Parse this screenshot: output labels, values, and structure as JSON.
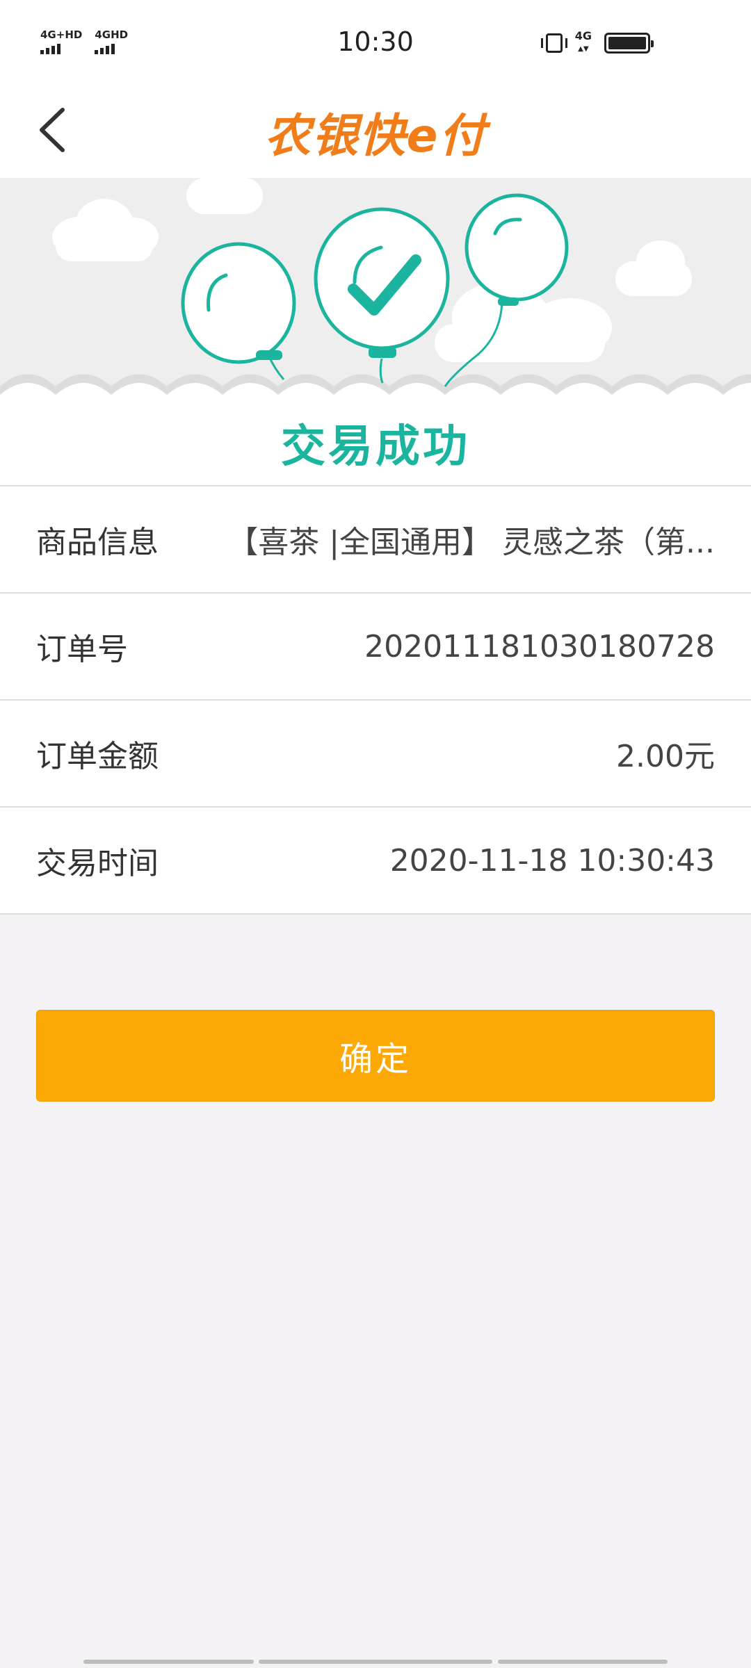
{
  "status_bar": {
    "time": "10:30",
    "sim1_label": "4G+HD",
    "sim2_label": "4GHD",
    "network_label": "4G",
    "icons": [
      "signal-icon",
      "vibrate-icon",
      "battery-icon"
    ]
  },
  "header": {
    "logo_text": "农银快e付",
    "back_icon": "chevron-left-icon",
    "brand_color": "#f07d1a"
  },
  "banner": {
    "title": "交易成功",
    "accent_color": "#1bb49e",
    "icon": "balloons-check-icon"
  },
  "details": [
    {
      "label": "商品信息",
      "value": "【喜茶 |全国通用】 灵感之茶（第..."
    },
    {
      "label": "订单号",
      "value": "2020111810301807​28"
    },
    {
      "label": "订单金额",
      "value": "2.00元"
    },
    {
      "label": "交易时间",
      "value": "2020-11-18 10:30:43"
    }
  ],
  "confirm_button": {
    "label": "确定",
    "color": "#fca905"
  }
}
